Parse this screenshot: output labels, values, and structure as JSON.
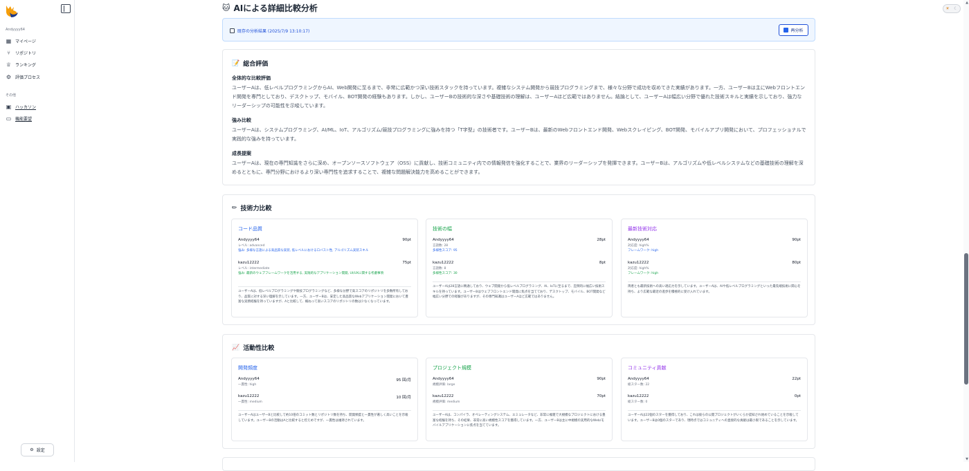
{
  "sidebar": {
    "user": "Andyyyy64",
    "section_other": "その他",
    "items": [
      {
        "label": "マイページ",
        "icon": "grid-icon"
      },
      {
        "label": "リポジトリ",
        "icon": "branch-icon"
      },
      {
        "label": "ランキング",
        "icon": "trophy-icon"
      },
      {
        "label": "評価プロセス",
        "icon": "gear-icon"
      }
    ],
    "other_items": [
      {
        "label": "ハッカソン",
        "icon": "calendar-icon"
      },
      {
        "label": "機能要望",
        "icon": "message-icon"
      }
    ],
    "settings_label": "設定"
  },
  "page": {
    "title": "AIによる詳細比較分析",
    "info_text": "既存の分析結果 (2025/7/9 13:10:17)",
    "reanalyze_label": "再分析"
  },
  "overall": {
    "title": "総合評価",
    "sections": [
      {
        "heading": "全体的な比較評価",
        "body": "ユーザーAは、低レベルプログラミングからAI、Web開発に至るまで、非常に広範かつ深い技術スタックを持っています。複雑なシステム開発から競技プログラミングまで、様々な分野で成功を収めてきた実績があります。一方、ユーザーBは主にWebフロントエンド開発を専門としており、デスクトップ、モバイル、BOT開発の経験もあります。しかし、ユーザーBの技術的な深さや基礎技術の理解は、ユーザーAほど広範ではありません。結論として、ユーザーAは幅広い分野で優れた技術スキルと実績を示しており、強力なリーダーシップの可能性を示唆しています。"
      },
      {
        "heading": "強み比較",
        "body": "ユーザーAは、システムプログラミング、AI/ML、IoT、アルゴリズム/競技プログラミングに強みを持つ「T字型」の技術者です。ユーザーBは、最新のWebフロントエンド開発、Webスクレイピング、BOT開発、モバイルアプリ開発において、プロフェッショナルで実践的な強みを持っています。"
      },
      {
        "heading": "成長提案",
        "body": "ユーザーAは、現在の専門知識をさらに深め、オープンソースソフトウェア（OSS）に貢献し、技術コミュニティ内での情報発信を強化することで、業界のリーダーシップを発揮できます。ユーザーBは、アルゴリズムや低レベルシステムなどの基礎技術の理解を深めるとともに、専門分野におけるより深い専門性を追求することで、複雑な問題解決能力を高めることができます。"
      }
    ]
  },
  "tech": {
    "title": "技術力比較",
    "cards": [
      {
        "title": "コード品質",
        "color": "blue",
        "a_name": "Andyyyy64",
        "a_score": "90pt",
        "a_detail1": "レベル: advanced",
        "a_detail2": "強み: 多様な言語による高品質な実装, 低レベルにおけるロバスト性, アルゴリズム実装スキル",
        "b_name": "kazu12222",
        "b_score": "75pt",
        "b_detail1": "レベル: intermediate",
        "b_detail2": "強み: 最新のウェブフレームワークを活用する, 実践的なアプリケーション開発, UI/UXに関する考慮事項",
        "summary": "ユーザーAは、低レベルプログラミングや競技プログラミングなど、多様な分野で高スコアのリポジトリを多数所有しており、品質に対する深い理解を示しています。一方、ユーザーBは、安定した高品質なWebアプリケーション開発において豊富な実務経験を持っていますが、Aと比較して、概ねって高いスコアのリポジトリの数は少なくなっています。"
      },
      {
        "title": "技術の幅",
        "color": "green",
        "a_name": "Andyyyy64",
        "a_score": "28pt",
        "a_detail1": "言語数: 28",
        "a_detail2": "多様性スコア: 95",
        "b_name": "kazu12222",
        "b_score": "8pt",
        "b_detail1": "言語数: 8",
        "b_detail2": "多様性スコア: 30",
        "summary": "ユーザーAは28言語に精通しており、ウェブ開発から低レベルプログラミング、AI、IoTに至るまで、圧倒的に幅広い技術スキルを持っています。ユーザーBはウェブフロントエンド開発に焦点を当てており、デスクトップ、モバイル、BOT開発など幅広い分野での経験がありますが、その専門知識はユーザーAほど広範ではありません。"
      },
      {
        "title": "最新技術対応",
        "color": "purple",
        "a_name": "Andyyyy64",
        "a_score": "90pt",
        "a_detail1": "対応度: high%",
        "a_detail2": "フレームワーク: high",
        "b_name": "kazu12222",
        "b_score": "80pt",
        "b_detail1": "対応度: high%",
        "b_detail2": "フレームワーク: high",
        "summary": "両者とも最新技術への高い適応力を示しています。ユーザーAは、AIや低レベルプログラミングといった最先端技術に関心を持ち、より広範な最近の進歩を積極的に受け入れています。"
      }
    ]
  },
  "activity": {
    "title": "活動性比較",
    "cards": [
      {
        "title": "開発頻度",
        "color": "blue",
        "a_name": "Andyyyy64",
        "a_score": "95 回/月",
        "a_detail1": "一貫性: high",
        "b_name": "kazu12222",
        "b_score": "10 回/月",
        "b_detail1": "一貫性: medium",
        "summary": "ユーザーAはユーザーBと比較して約10倍のコミット数とリポジトリ数を持ち、開発頻度と一貫性が著しく高いことを示唆しています。ユーザーBの活動はAと比較すると控えめですが、一貫性は維持されています。"
      },
      {
        "title": "プロジェクト規模",
        "color": "green",
        "a_name": "Andyyyy64",
        "a_score": "90pt",
        "a_detail1": "規模評価: large",
        "b_name": "kazu12222",
        "b_score": "70pt",
        "b_detail1": "規模評価: medium",
        "summary": "ユーザーAは、コンパイラ、オペレーティングシステム、エミュレータなど、非常に複雑で大規模なプロジェクトにおける豊富な経験を持ち、その結果、非常に高い規模性スコアを獲得しています。一方、ユーザーBは主に中規模の実用的なWeb/モバイルアプリケーションに焦点を当てています。"
      },
      {
        "title": "コミュニティ貢献",
        "color": "purple",
        "a_name": "Andyyyy64",
        "a_score": "22pt",
        "a_detail1": "総スター数: 22",
        "b_name": "kazu12222",
        "b_score": "0pt",
        "b_detail1": "総スター数: 0",
        "summary": "ユーザーAは22個のスターを獲得しており、これは彼らの公開プロジェクトがいくらか認知され始めていることを示唆しています。ユーザーBは0個のスターであり、現時点ではコミュニティへの直接的な貢献は最小限であることを示しています。"
      }
    ]
  }
}
